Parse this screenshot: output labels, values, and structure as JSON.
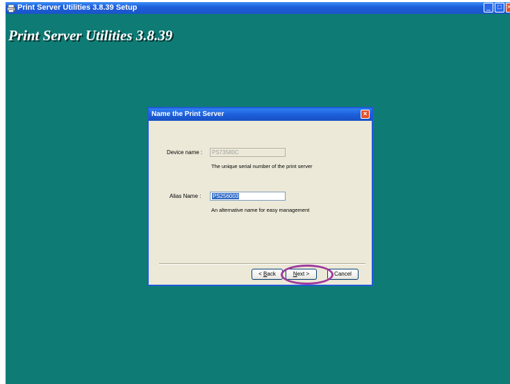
{
  "window": {
    "title": "Print Server Utilities 3.8.39 Setup",
    "banner": "Print Server Utilities 3.8.39",
    "controls": {
      "minimize": "_",
      "maximize": "□",
      "close": "×"
    }
  },
  "dialog": {
    "title": "Name the Print Server",
    "close": "×",
    "device_name_label": "Device name :",
    "device_name_value": "PS73580C",
    "device_name_hint": "The unique serial number of the print server",
    "alias_name_label": "Alias Name :",
    "alias_name_value": "PS256003",
    "alias_name_hint": "An alternative name for easy management",
    "buttons": {
      "back_prefix": "< ",
      "back_mnemonic": "B",
      "back_rest": "ack",
      "next_mnemonic": "N",
      "next_rest": "ext >",
      "cancel": "Cancel"
    }
  },
  "colors": {
    "desktop": "#0f7b75",
    "titlebar": "#1d5fdb",
    "highlight": "#a0399c"
  }
}
